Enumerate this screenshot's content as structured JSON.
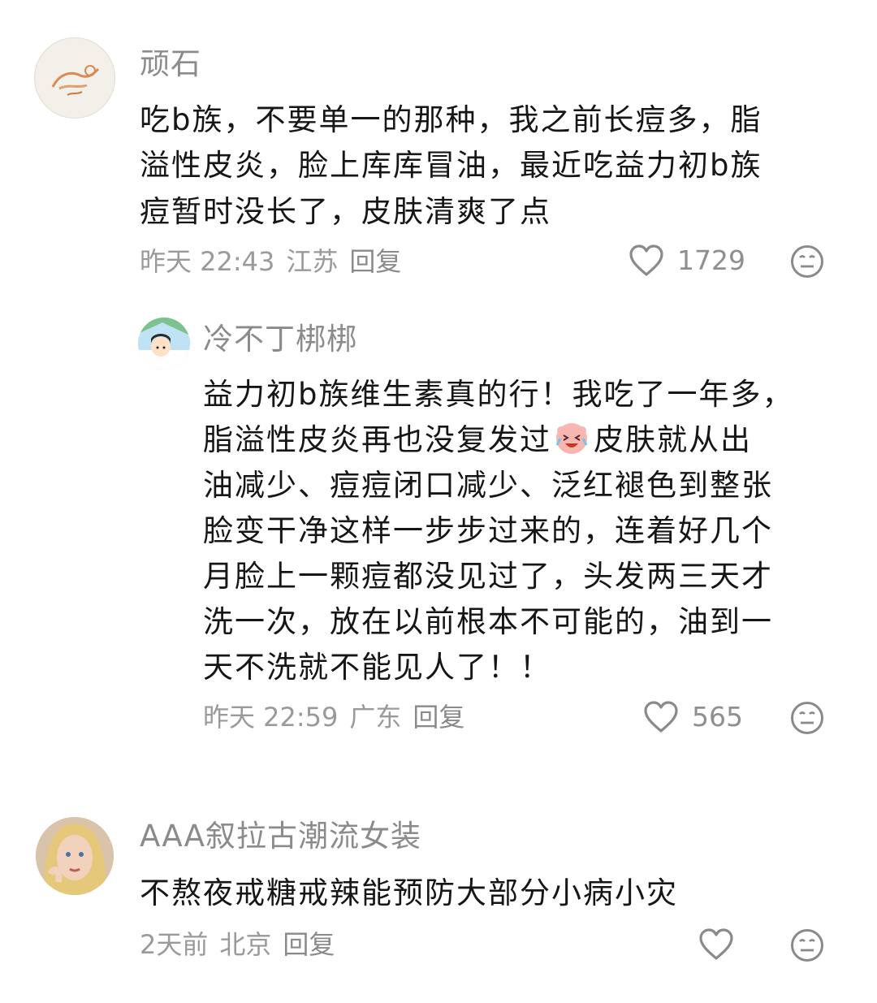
{
  "comments": [
    {
      "user": "顽石",
      "lines": [
        "吃b族，不要单一的那种，我之前长痘多，脂",
        "溢性皮炎，脸上库库冒油，最近吃益力初b族",
        "痘暂时没长了，皮肤清爽了点"
      ],
      "time": "昨天 22:43",
      "location": "江苏",
      "reply_label": "回复",
      "likes": "1729"
    },
    {
      "user": "冷不丁梆梆",
      "lines": [
        "益力初b族维生素真的行！我吃了一年多，",
        "脂溢性皮炎再也没复发过",
        "皮肤就从出",
        "油减少、痘痘闭口减少、泛红褪色到整张",
        "脸变干净这样一步步过来的，连着好几个",
        "月脸上一颗痘都没见过了，头发两三天才",
        "洗一次，放在以前根本不可能的，油到一",
        "天不洗就不能见人了！！"
      ],
      "time": "昨天 22:59",
      "location": "广东",
      "reply_label": "回复",
      "likes": "565"
    },
    {
      "user": "AAA叙拉古潮流女装",
      "lines": [
        "不熬夜戒糖戒辣能预防大部分小病小灾"
      ],
      "time": "2天前",
      "location": "北京",
      "reply_label": "回复",
      "likes": ""
    }
  ],
  "icons": {
    "like": "heart-outline-icon",
    "react": "neutral-face-icon",
    "inline_emoji": "crying-laugh-emoji"
  },
  "colors": {
    "text": "#161616",
    "meta": "#9a9a9a",
    "name": "#8b8b8b"
  }
}
